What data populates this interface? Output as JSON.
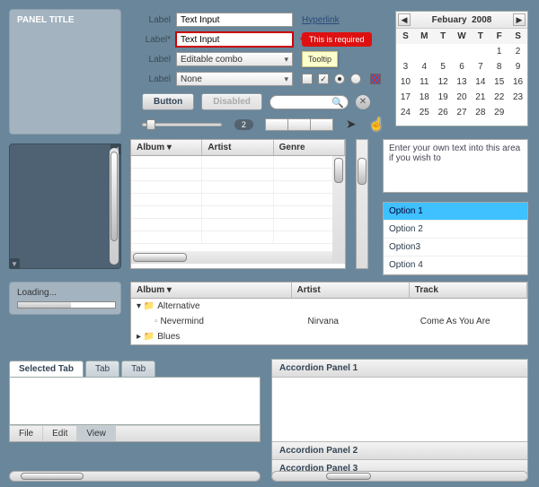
{
  "panel": {
    "title": "PANEL TITLE"
  },
  "form": {
    "row1": {
      "label": "Label",
      "value": "Text Input",
      "link": "Hyperlink"
    },
    "row2": {
      "label": "Label*",
      "value": "Text Input",
      "error": "This is required"
    },
    "row3": {
      "label": "Label",
      "value": "Editable combo",
      "tooltip": "Tooltip"
    },
    "row4": {
      "label": "Label",
      "value": "None"
    }
  },
  "buttons": {
    "primary": "Button",
    "disabled": "Disabled"
  },
  "counter": "2",
  "calendar": {
    "month": "Febuary",
    "year": "2008",
    "dow": [
      "S",
      "M",
      "T",
      "W",
      "T",
      "F",
      "S"
    ],
    "days": [
      "",
      "",
      "",
      "",
      "",
      "1",
      "2",
      "3",
      "4",
      "5",
      "6",
      "7",
      "8",
      "9",
      "10",
      "11",
      "12",
      "13",
      "14",
      "15",
      "16",
      "17",
      "18",
      "19",
      "20",
      "21",
      "22",
      "23",
      "24",
      "25",
      "26",
      "27",
      "28",
      "29",
      "",
      ""
    ]
  },
  "grid1": {
    "cols": [
      "Album ▾",
      "Artist",
      "Genre"
    ]
  },
  "textarea": "Enter your own text into this area if you wish to",
  "list": {
    "items": [
      "Option 1",
      "Option 2",
      "Option3",
      "Option 4"
    ],
    "selected": 0
  },
  "tree": {
    "cols": [
      "Album ▾",
      "Artist",
      "Track"
    ],
    "r1": {
      "expander": "▾",
      "label": "Alternative"
    },
    "r2": {
      "album": "Nevermind",
      "artist": "Nirvana",
      "track": "Come As You Are"
    },
    "r3": {
      "expander": "▸",
      "label": "Blues"
    }
  },
  "loading": {
    "label": "Loading..."
  },
  "tabs": {
    "t1": "Selected Tab",
    "t2": "Tab",
    "t3": "Tab"
  },
  "menu": {
    "m1": "File",
    "m2": "Edit",
    "m3": "View"
  },
  "accordion": {
    "p1": "Accordion Panel 1",
    "p2": "Accordion Panel 2",
    "p3": "Accordion Panel 3"
  }
}
